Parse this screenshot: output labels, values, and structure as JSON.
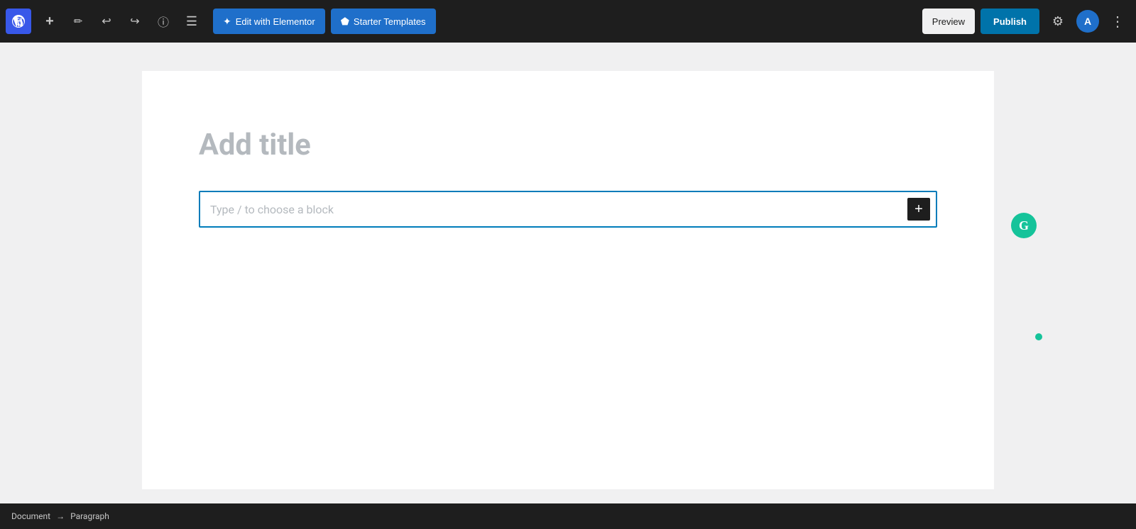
{
  "toolbar": {
    "wp_logo": "W",
    "add_label": "+",
    "pencil_label": "✏",
    "undo_label": "↩",
    "redo_label": "↪",
    "info_label": "ⓘ",
    "list_label": "≡",
    "elementor_btn_label": "Edit with Elementor",
    "starter_btn_label": "Starter Templates",
    "preview_label": "Preview",
    "publish_label": "Publish",
    "gear_label": "⚙",
    "avatar_label": "A",
    "more_label": "⋮"
  },
  "editor": {
    "title_placeholder": "Add title",
    "block_placeholder": "Type / to choose a block",
    "add_block_label": "+"
  },
  "statusbar": {
    "document_label": "Document",
    "arrow": "→",
    "paragraph_label": "Paragraph"
  },
  "colors": {
    "primary_blue": "#0073aa",
    "elementor_blue": "#1f6fca",
    "grammarly_green": "#15c39a",
    "toolbar_bg": "#1e1e1e"
  }
}
